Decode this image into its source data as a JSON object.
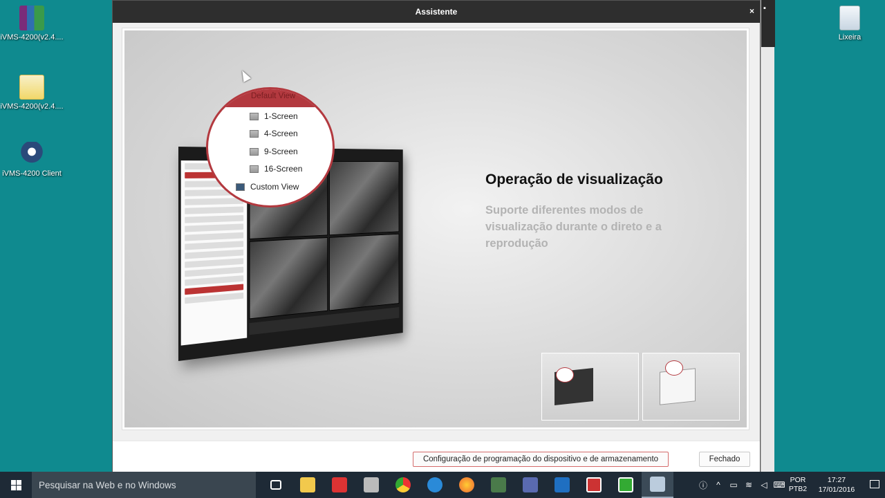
{
  "desktop": {
    "icons": [
      {
        "label": "iVMS-4200(v2.4...."
      },
      {
        "label": "iVMS-4200(v2.4...."
      },
      {
        "label": "iVMS-4200 Client"
      },
      {
        "label": "Lixeira"
      }
    ]
  },
  "dialog": {
    "title": "Assistente",
    "close_symbol": "×",
    "slide": {
      "title": "Operação de visualização",
      "description": "Suporte diferentes modos de visualização durante o direto e a reprodução",
      "bubble": {
        "header": "Default View",
        "items": [
          "1-Screen",
          "4-Screen",
          "9-Screen",
          "16-Screen",
          "Custom View"
        ]
      }
    },
    "buttons": {
      "config": "Configuração de programação do dispositivo e de armazenamento",
      "close": "Fechado"
    }
  },
  "taskbar": {
    "search_placeholder": "Pesquisar na Web e no Windows",
    "language": {
      "line1": "POR",
      "line2": "PTB2"
    },
    "clock": {
      "time": "17:27",
      "date": "17/01/2016"
    }
  },
  "colors": {
    "accent_red": "#b3393f",
    "desktop": "#0f8a8f",
    "taskbar": "#1e2a36"
  }
}
